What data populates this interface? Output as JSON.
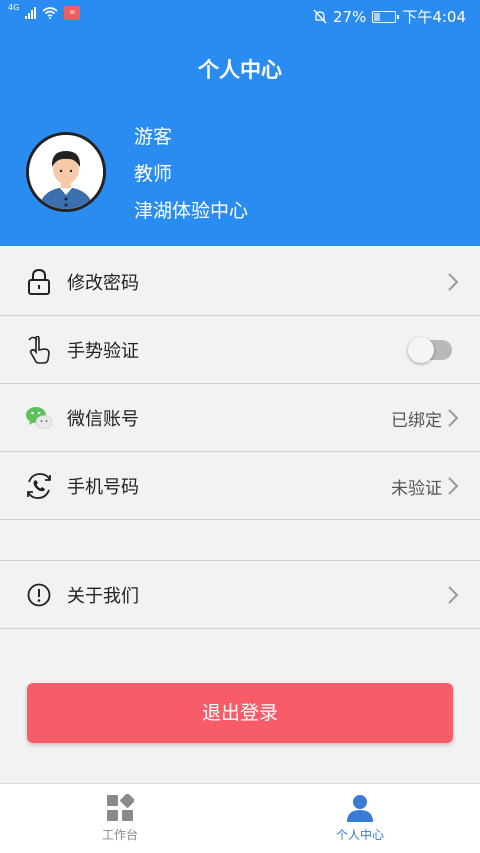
{
  "statusbar": {
    "signal_label": "4G",
    "battery_percent": "27%",
    "time": "下午4:04",
    "battery_level": 0.27
  },
  "header": {
    "title": "个人中心",
    "user": {
      "name": "游客",
      "role": "教师",
      "organization": "津湖体验中心"
    }
  },
  "menu": {
    "change_password": {
      "label": "修改密码"
    },
    "gesture_verify": {
      "label": "手势验证",
      "enabled": false
    },
    "wechat": {
      "label": "微信账号",
      "status": "已绑定"
    },
    "phone": {
      "label": "手机号码",
      "status": "未验证"
    },
    "about": {
      "label": "关于我们"
    }
  },
  "logout_label": "退出登录",
  "tabbar": {
    "workbench": "工作台",
    "profile": "个人中心"
  },
  "colors": {
    "primary": "#2a8cf0",
    "logout": "#f95c69",
    "tab_active": "#3a7bd5"
  }
}
